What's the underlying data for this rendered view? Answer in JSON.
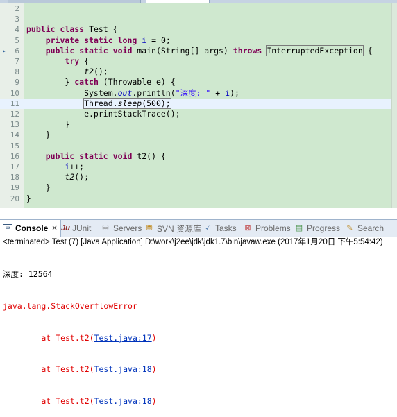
{
  "editor": {
    "lines": [
      {
        "n": "2",
        "text": ""
      },
      {
        "n": "3",
        "text": ""
      },
      {
        "n": "4",
        "text": "public class Test {"
      },
      {
        "n": "5",
        "text": "    private static long i = 0;"
      },
      {
        "n": "6",
        "text": "    public static void main(String[] args) throws InterruptedException {"
      },
      {
        "n": "7",
        "text": "        try {"
      },
      {
        "n": "8",
        "text": "            t2();"
      },
      {
        "n": "9",
        "text": "        } catch (Throwable e) {"
      },
      {
        "n": "10",
        "text": "            System.out.println(\"深度: \" + i);"
      },
      {
        "n": "11",
        "text": "            Thread.sleep(500);"
      },
      {
        "n": "12",
        "text": "            e.printStackTrace();"
      },
      {
        "n": "13",
        "text": "        }"
      },
      {
        "n": "14",
        "text": "    }"
      },
      {
        "n": "15",
        "text": ""
      },
      {
        "n": "16",
        "text": "    public static void t2() {"
      },
      {
        "n": "17",
        "text": "        i++;"
      },
      {
        "n": "18",
        "text": "        t2();"
      },
      {
        "n": "19",
        "text": "    }"
      },
      {
        "n": "20",
        "text": "}"
      }
    ],
    "current_line": "11"
  },
  "views": {
    "tabs": [
      {
        "label": "Console",
        "icon": "console-icon",
        "active": true
      },
      {
        "label": "JUnit",
        "icon": "junit-icon"
      },
      {
        "label": "Servers",
        "icon": "servers-icon"
      },
      {
        "label": "SVN 资源库",
        "icon": "svn-icon"
      },
      {
        "label": "Tasks",
        "icon": "tasks-icon"
      },
      {
        "label": "Problems",
        "icon": "problems-icon"
      },
      {
        "label": "Progress",
        "icon": "progress-icon"
      },
      {
        "label": "Search",
        "icon": "search-icon"
      }
    ],
    "close_glyph": "✕"
  },
  "console": {
    "header": "<terminated> Test (7) [Java Application] D:\\work\\j2ee\\jdk\\jdk1.7\\bin\\javaw.exe (2017年1月20日 下午5:54:42)",
    "depth_line": "深度: 12564",
    "error": "java.lang.StackOverflowError",
    "frames": [
      {
        "prefix": "        at Test.t2(",
        "link": "Test.java:17",
        "suffix": ")"
      },
      {
        "prefix": "        at Test.t2(",
        "link": "Test.java:18",
        "suffix": ")"
      },
      {
        "prefix": "        at Test.t2(",
        "link": "Test.java:18",
        "suffix": ")"
      }
    ]
  },
  "colors": {
    "editor_bg": "#cfe8cf",
    "keyword": "#7f0055",
    "field": "#0000c0",
    "string": "#2a00ff",
    "error": "#e00000",
    "link": "#0033bb"
  }
}
